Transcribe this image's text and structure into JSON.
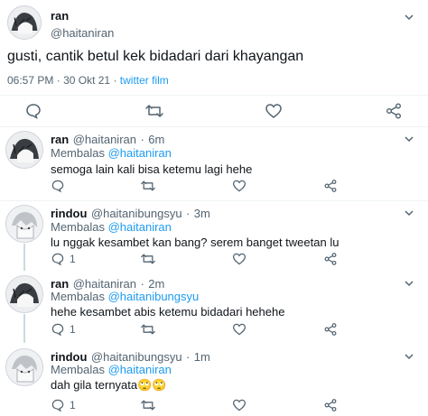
{
  "main_tweet": {
    "name": "ran",
    "handle": "@haitaniran",
    "text": "gusti, cantik betul kek bidadari dari khayangan",
    "time": "06:57 PM",
    "date": "30 Okt 21",
    "source": "twitter film"
  },
  "replies": [
    {
      "name": "ran",
      "handle": "@haitaniran",
      "age": "6m",
      "replying_label": "Membalas",
      "replying_to": "@haitaniran",
      "text": "semoga lain kali bisa ketemu lagi hehe",
      "reply_count": ""
    },
    {
      "name": "rindou",
      "handle": "@haitanibungsyu",
      "age": "3m",
      "replying_label": "Membalas",
      "replying_to": "@haitaniran",
      "text": "lu nggak kesambet kan bang? serem banget tweetan lu",
      "reply_count": "1"
    },
    {
      "name": "ran",
      "handle": "@haitaniran",
      "age": "2m",
      "replying_label": "Membalas",
      "replying_to": "@haitanibungsyu",
      "text": "hehe kesambet abis ketemu bidadari hehehe",
      "reply_count": "1"
    },
    {
      "name": "rindou",
      "handle": "@haitanibungsyu",
      "age": "1m",
      "replying_label": "Membalas",
      "replying_to": "@haitaniran",
      "text": "dah gila ternyata🙄🙄",
      "reply_count": "1"
    }
  ],
  "separator": "·",
  "colors": {
    "link": "#1d9bf0",
    "muted": "#536471",
    "divider": "#eff3f4"
  }
}
